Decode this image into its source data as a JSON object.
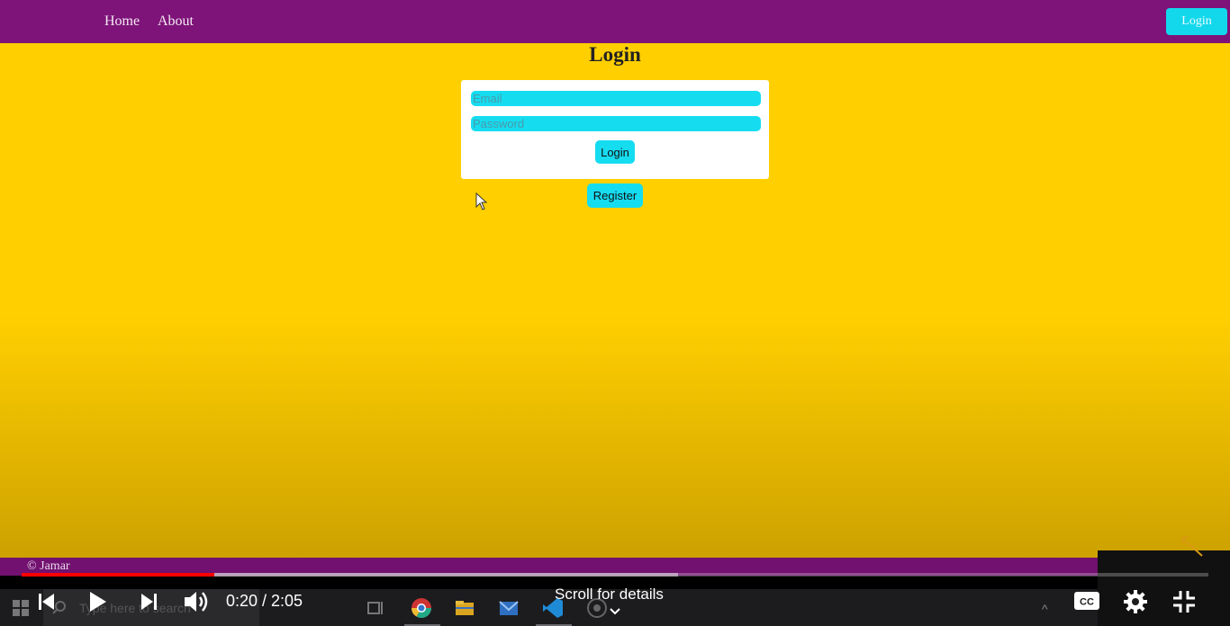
{
  "nav": {
    "links": [
      "Home",
      "About"
    ],
    "login_button": "Login"
  },
  "login": {
    "title": "Login",
    "email_placeholder": "Email",
    "password_placeholder": "Password",
    "submit_label": "Login",
    "register_label": "Register"
  },
  "footer": {
    "text": "© Jamar"
  },
  "player": {
    "time_display": "0:20 / 2:05",
    "scroll_hint": "Scroll for details",
    "played_fraction": 0.162,
    "buffered_fraction": 0.553
  },
  "taskbar": {
    "search_placeholder": "Type here to search"
  },
  "colors": {
    "page_bg": "#ffcf00",
    "navbar": "#7e1479",
    "accent_cyan": "#16dcf0",
    "progress_red": "#ff0000"
  },
  "icons": [
    "windows-icon",
    "search-icon",
    "task-view-icon",
    "chrome-icon",
    "file-explorer-icon",
    "mail-icon",
    "vscode-icon",
    "app-icon",
    "previous-icon",
    "play-icon",
    "next-icon",
    "volume-icon",
    "cc-icon",
    "settings-icon",
    "exit-fullscreen-icon"
  ]
}
